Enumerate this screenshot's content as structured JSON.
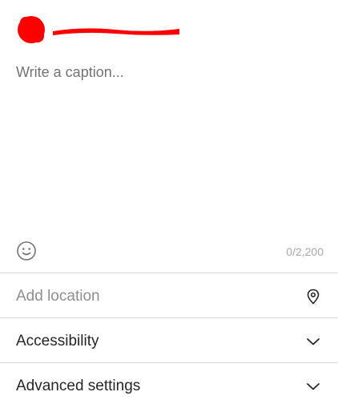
{
  "caption": {
    "placeholder": "Write a caption...",
    "value": ""
  },
  "char_count": "0/2,200",
  "rows": {
    "location": {
      "label": "Add location",
      "icon": "map-pin-icon"
    },
    "accessibility": {
      "label": "Accessibility",
      "icon": "chevron-down-icon"
    },
    "advanced": {
      "label": "Advanced settings",
      "icon": "chevron-down-icon"
    }
  },
  "colors": {
    "redaction": "#ff0000",
    "text": "#262626",
    "placeholder": "#737373",
    "divider": "#dbdbdb",
    "muted": "#a8a8a8"
  }
}
